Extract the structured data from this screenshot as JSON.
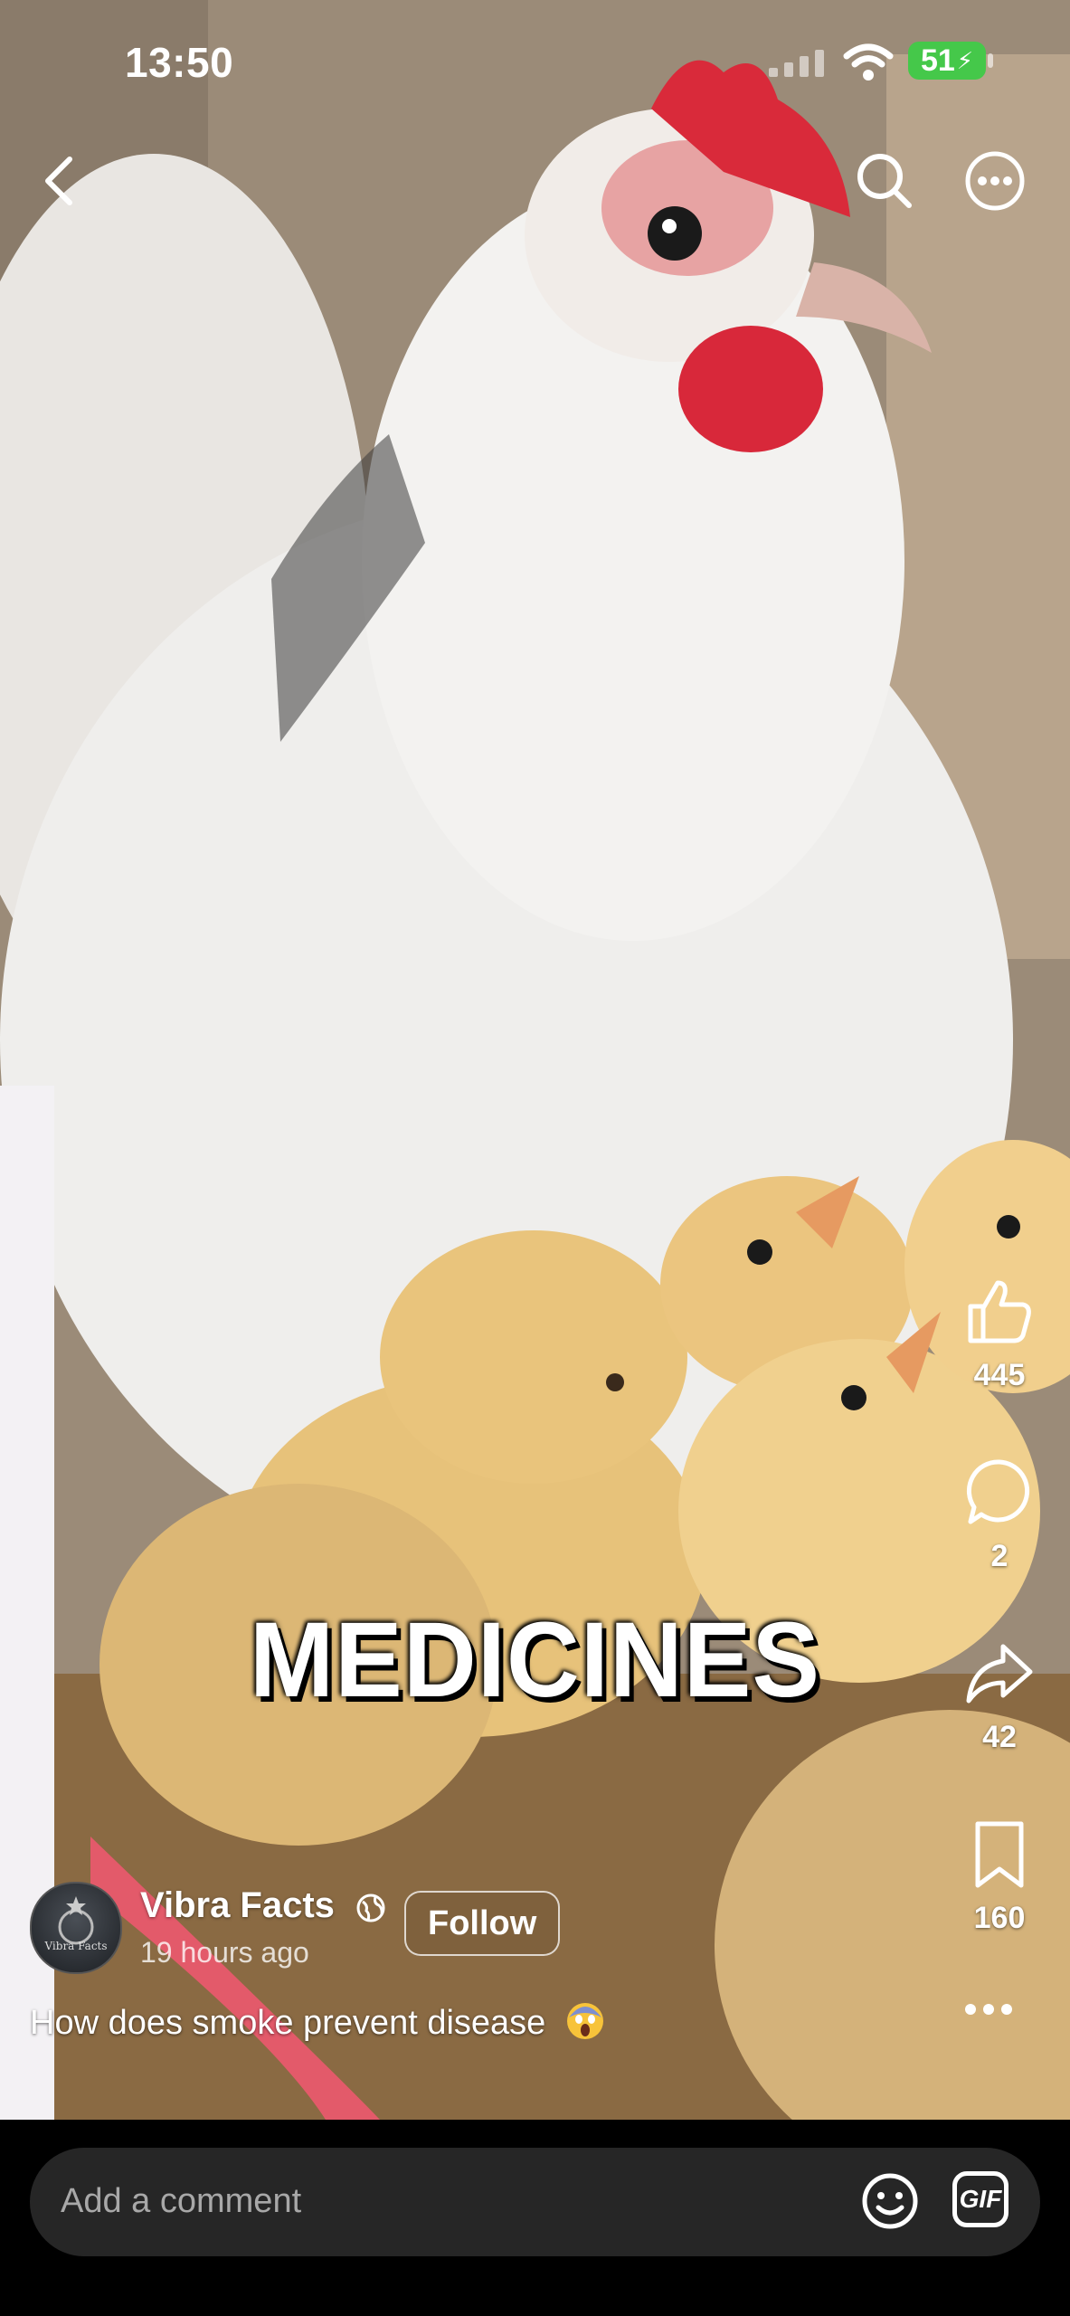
{
  "status_bar": {
    "time": "13:50",
    "battery": "51"
  },
  "top_bar": {
    "back_icon": "chevron-left-icon",
    "search_icon": "search-icon",
    "more_icon": "more-circle-icon"
  },
  "video": {
    "overlay_text": "MEDICINES"
  },
  "actions": {
    "like": {
      "icon": "thumbs-up-icon",
      "count": "445"
    },
    "comment": {
      "icon": "comment-bubble-icon",
      "count": "2"
    },
    "share": {
      "icon": "share-arrow-icon",
      "count": "42"
    },
    "save": {
      "icon": "bookmark-icon",
      "count": "160"
    },
    "more_icon": "more-dots-icon"
  },
  "author": {
    "name": "Vibra Facts",
    "avatar_text": "Vibra Facts",
    "posted": "19 hours ago",
    "visibility_icon": "globe-icon",
    "follow_label": "Follow"
  },
  "caption": {
    "text": "How does smoke prevent disease",
    "emoji": "😱"
  },
  "comment_bar": {
    "placeholder": "Add a comment",
    "emoji_icon": "smiley-icon",
    "gif_label": "GIF"
  }
}
